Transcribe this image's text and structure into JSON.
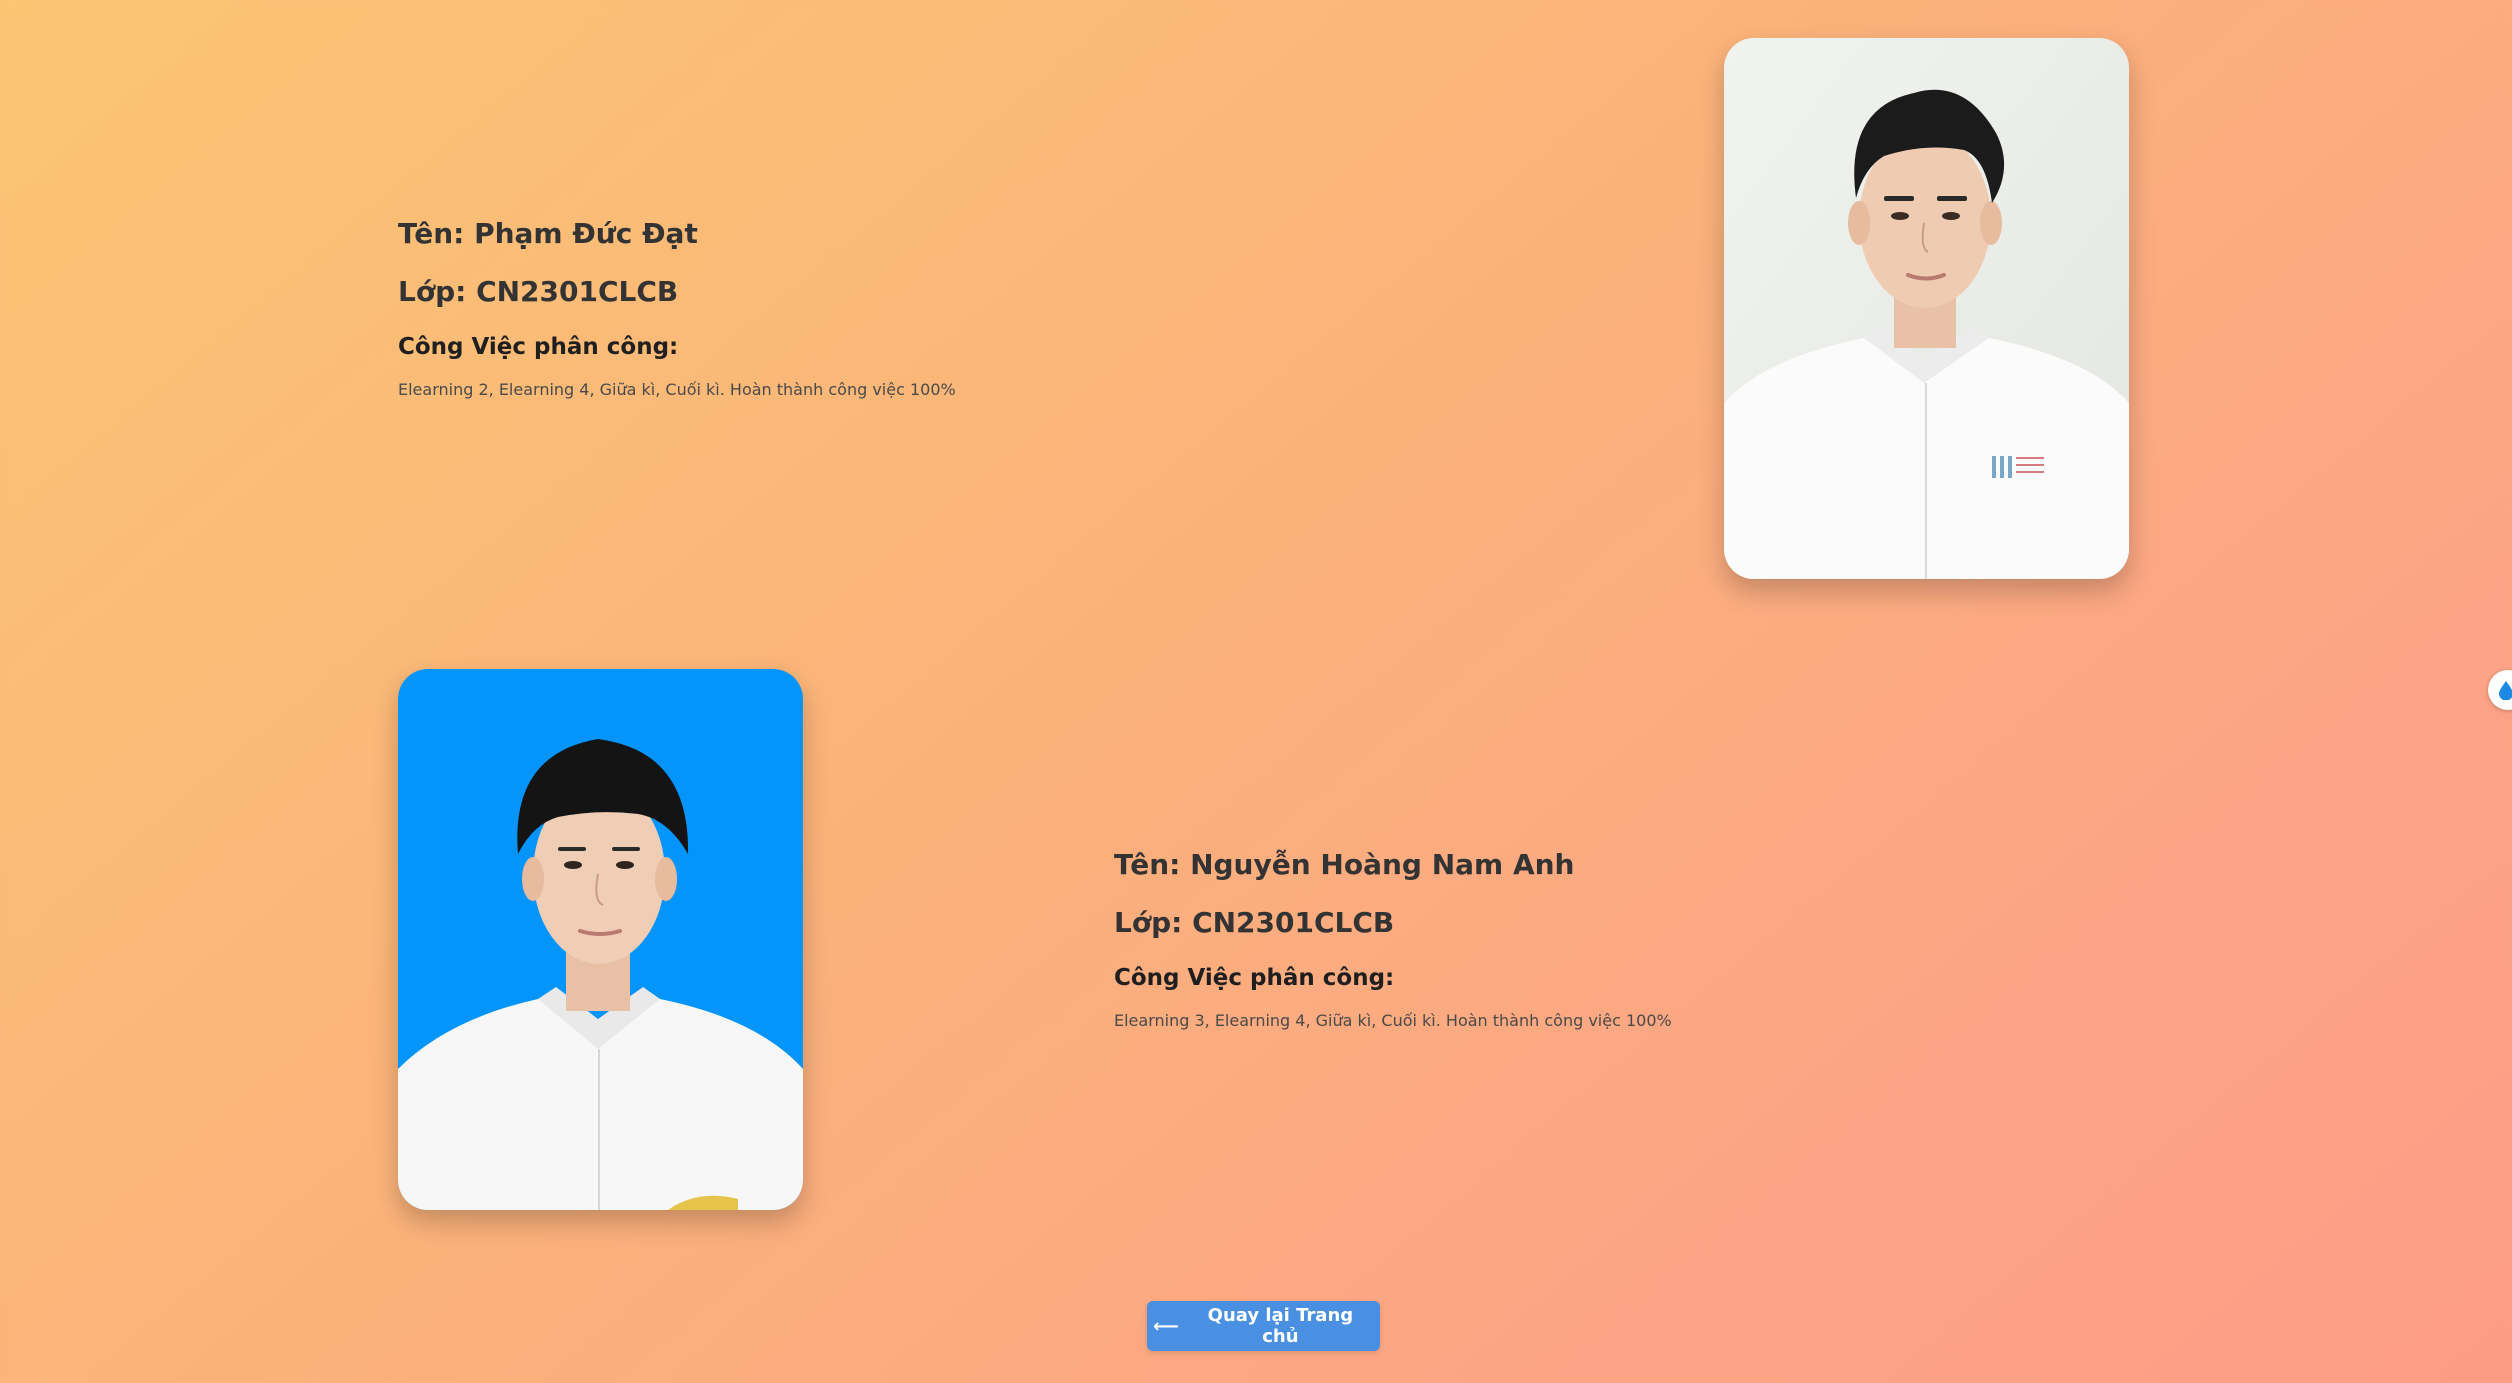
{
  "members": [
    {
      "name": "Tên: Phạm Đức Đạt",
      "class": "Lớp: CN2301CLCB",
      "task_heading": "Công Việc phân công:",
      "task_text": "Elearning 2, Elearning 4, Giữa kì, Cuối kì. Hoàn thành công việc 100%",
      "photo_icon": "portrait-photo-white-background"
    },
    {
      "name": "Tên: Nguyễn Hoàng Nam Anh",
      "class": "Lớp: CN2301CLCB",
      "task_heading": "Công Việc phân công:",
      "task_text": "Elearning 3, Elearning 4, Giữa kì, Cuối kì. Hoàn thành công việc 100%",
      "photo_icon": "portrait-photo-blue-background"
    }
  ],
  "back_button": {
    "label": "Quay lại Trang chủ",
    "icon": "arrow-left-icon"
  },
  "side_widget": {
    "icon": "droplet-icon"
  },
  "colors": {
    "gradient_start": "#fbc574",
    "gradient_end": "#fd9c86",
    "button": "#4a90e2",
    "photo2_background": "#0395fb"
  }
}
